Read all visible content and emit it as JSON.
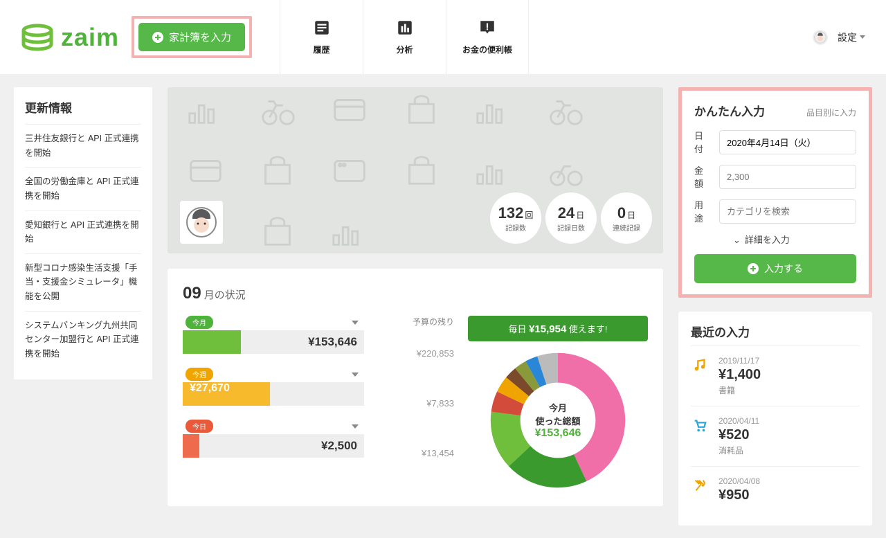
{
  "header": {
    "logo_text": "zaim",
    "input_budget_label": "家計簿を入力",
    "nav": [
      {
        "label": "履歴"
      },
      {
        "label": "分析"
      },
      {
        "label": "お金の便利帳"
      }
    ],
    "settings_label": "設定"
  },
  "news": {
    "title": "更新情報",
    "items": [
      "三井住友銀行と API 正式連携を開始",
      "全国の労働金庫と API 正式連携を開始",
      "愛知銀行と API 正式連携を開始",
      "新型コロナ感染生活支援「手当・支援金シミュレータ」機能を公開",
      "システムバンキング九州共同センター加盟行と API 正式連携を開始"
    ]
  },
  "hero_stats": [
    {
      "num": "132",
      "unit": "回",
      "label": "記録数"
    },
    {
      "num": "24",
      "unit": "日",
      "label": "記録日数"
    },
    {
      "num": "0",
      "unit": "日",
      "label": "連続記録"
    }
  ],
  "month": {
    "num": "09",
    "title_suffix": "月の状況",
    "bars": [
      {
        "tag": "今月",
        "tag_color": "#4fb23a",
        "fill_color": "#6fbf3c",
        "fill_pct": 32,
        "value": "¥153,646",
        "inner": ""
      },
      {
        "tag": "今週",
        "tag_color": "#f0a400",
        "fill_color": "#f6ba2c",
        "fill_pct": 48,
        "value": "",
        "inner": "¥27,670"
      },
      {
        "tag": "今日",
        "tag_color": "#e85a3a",
        "fill_color": "#ee6c4d",
        "fill_pct": 9,
        "value": "¥2,500",
        "inner": ""
      }
    ],
    "budget_head": "予算の残り",
    "budget_vals": [
      "¥220,853",
      "¥7,833",
      "¥13,454"
    ],
    "daily_prefix": "毎日 ",
    "daily_amount": "¥15,954",
    "daily_suffix": " 使えます!",
    "donut_center": {
      "l1": "今月",
      "l2": "使った総額",
      "l3": "¥153,646"
    }
  },
  "chart_data": {
    "type": "pie",
    "title": "今月 使った総額",
    "total_label": "¥153,646",
    "series": [
      {
        "name": "slice-pink",
        "pct": 43,
        "color": "#f16fa8"
      },
      {
        "name": "slice-green-dark",
        "pct": 20,
        "color": "#3a9a2e"
      },
      {
        "name": "slice-green",
        "pct": 14,
        "color": "#6fbf3c"
      },
      {
        "name": "slice-red",
        "pct": 5,
        "color": "#d34b3b"
      },
      {
        "name": "slice-orange",
        "pct": 4,
        "color": "#f0a400"
      },
      {
        "name": "slice-brown",
        "pct": 3,
        "color": "#7a4a2a"
      },
      {
        "name": "slice-olive",
        "pct": 3,
        "color": "#8a9a3a"
      },
      {
        "name": "slice-blue",
        "pct": 3,
        "color": "#2a86d6"
      },
      {
        "name": "slice-misc",
        "pct": 5,
        "color": "#bbb"
      }
    ]
  },
  "quick": {
    "title": "かんたん入力",
    "alt_link": "品目別に入力",
    "date_label": "日付",
    "date_value": "2020年4月14日（火）",
    "amount_label": "金額",
    "amount_placeholder": "2,300",
    "purpose_label": "用途",
    "purpose_placeholder": "カテゴリを検索",
    "detail_label": "詳細を入力",
    "submit_label": "入力する"
  },
  "recent": {
    "title": "最近の入力",
    "items": [
      {
        "date": "2019/11/17",
        "amount": "¥1,400",
        "category": "書籍",
        "icon": "music",
        "color": "#f0a400"
      },
      {
        "date": "2020/04/11",
        "amount": "¥520",
        "category": "消耗品",
        "icon": "cart",
        "color": "#2aa8d8"
      },
      {
        "date": "2020/04/08",
        "amount": "¥950",
        "category": "",
        "icon": "food",
        "color": "#f0a400"
      }
    ]
  }
}
